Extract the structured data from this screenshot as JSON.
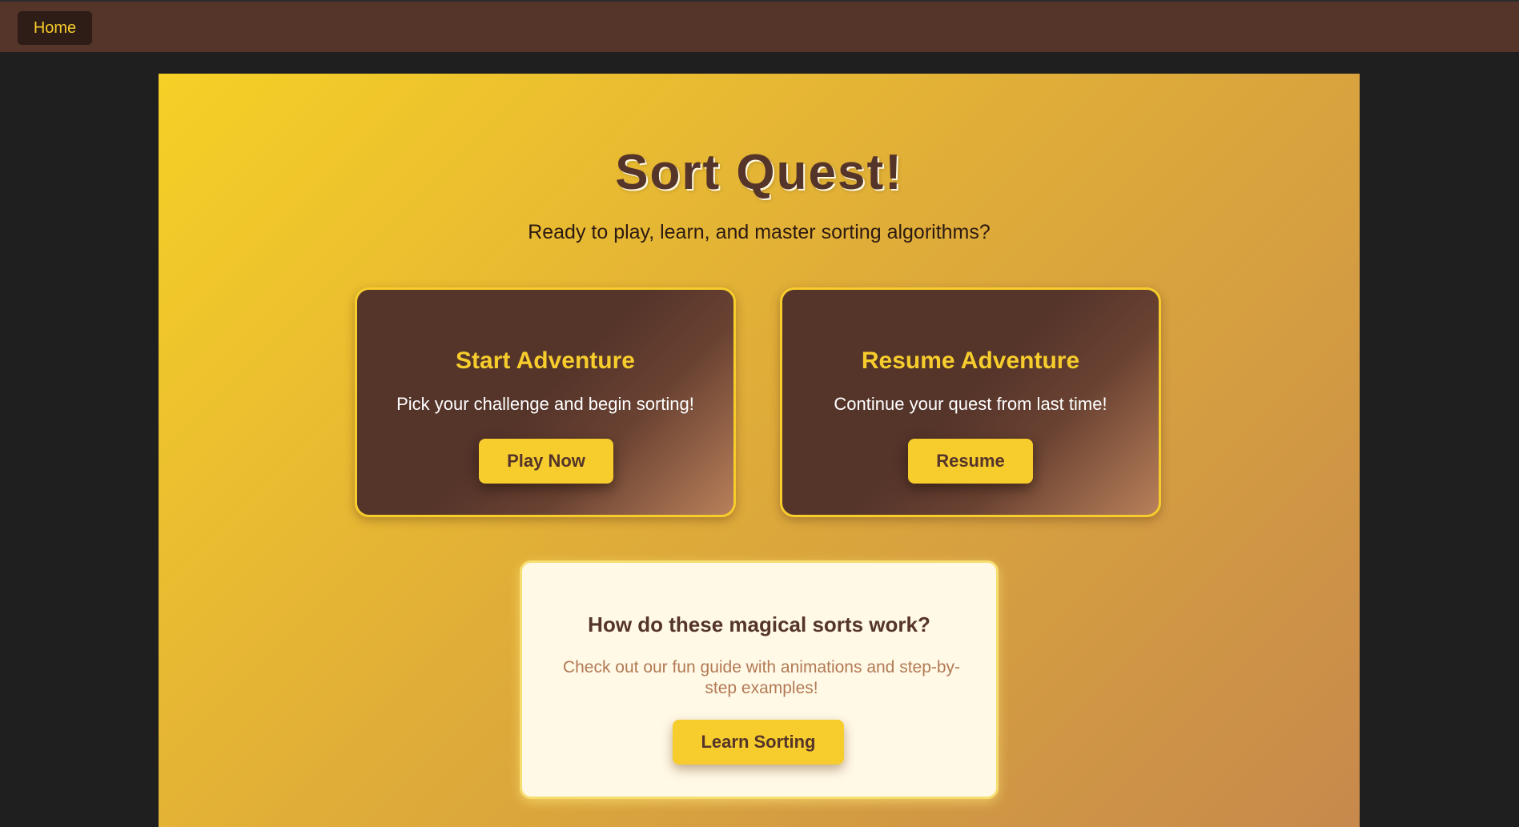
{
  "nav": {
    "home_label": "Home"
  },
  "hero": {
    "title": "Sort Quest!",
    "subtitle": "Ready to play, learn, and master sorting algorithms?"
  },
  "cards": {
    "start": {
      "title": "Start Adventure",
      "text": "Pick your challenge and begin sorting!",
      "button_label": "Play Now"
    },
    "resume": {
      "title": "Resume Adventure",
      "text": "Continue your quest from last time!",
      "button_label": "Resume"
    }
  },
  "guide": {
    "title": "How do these magical sorts work?",
    "text": "Check out our fun guide with animations and step-by-step examples!",
    "button_label": "Learn Sorting"
  },
  "colors": {
    "accent": "#f6cd2c",
    "brown": "#55342a",
    "page_background": "#1f1f1f",
    "guide_background": "#fff9e6"
  }
}
